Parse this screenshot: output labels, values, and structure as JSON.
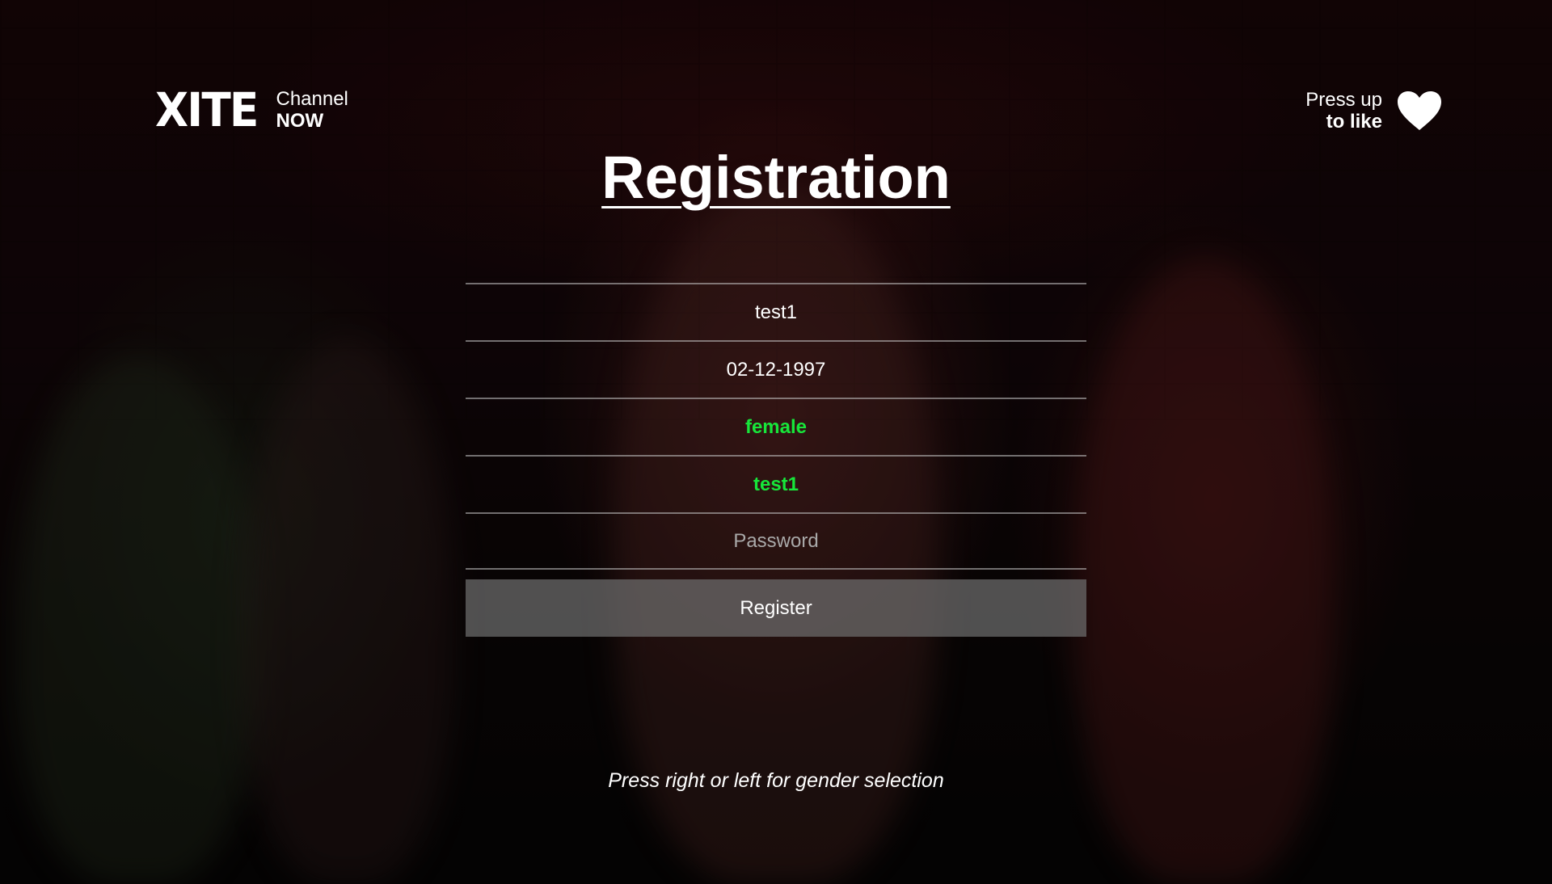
{
  "brand": {
    "logo": "XITE",
    "channel_label": "Channel",
    "channel_name": "NOW"
  },
  "like_hint": {
    "line1": "Press up",
    "line2": "to like",
    "icon": "heart-icon"
  },
  "title": "Registration",
  "form": {
    "fields": [
      {
        "name": "username",
        "value": "test1",
        "state": "filled"
      },
      {
        "name": "birthdate",
        "value": "02-12-1997",
        "state": "filled"
      },
      {
        "name": "gender",
        "value": "female",
        "state": "focused"
      },
      {
        "name": "country",
        "value": "test1",
        "state": "focused"
      },
      {
        "name": "password",
        "value": "",
        "placeholder": "Password",
        "state": "empty"
      }
    ],
    "register_label": "Register"
  },
  "hint": "Press right or left for gender selection",
  "colors": {
    "accent_selected": "#17e63a",
    "text": "#ffffff",
    "placeholder": "#a9a9a9",
    "button_bg": "#6e6e6e"
  }
}
